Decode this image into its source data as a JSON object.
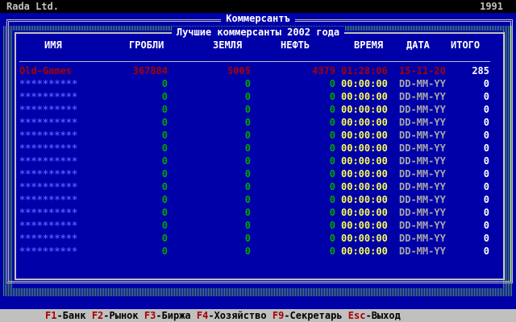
{
  "header": {
    "company": "Rada Ltd.",
    "year": "1991"
  },
  "window": {
    "title": "Коммерсантъ",
    "subtitle": "Лучшие коммерсанты 2002 года"
  },
  "columns": [
    "ИМЯ",
    "ГРОБЛИ",
    "ЗЕМЛЯ",
    "НЕФТЬ",
    "ВРЕМЯ",
    "ДАТА",
    "ИТОГО"
  ],
  "leaderboard": [
    {
      "name": "Old-Games",
      "grobli": "367884",
      "zemlya": "5005",
      "neft": "4379",
      "time": "01:28:06",
      "date": "15-11-20",
      "total": "285"
    },
    {
      "name": "**********",
      "grobli": "0",
      "zemlya": "0",
      "neft": "0",
      "time": "00:00:00",
      "date": "DD-MM-YY",
      "total": "0"
    },
    {
      "name": "**********",
      "grobli": "0",
      "zemlya": "0",
      "neft": "0",
      "time": "00:00:00",
      "date": "DD-MM-YY",
      "total": "0"
    },
    {
      "name": "**********",
      "grobli": "0",
      "zemlya": "0",
      "neft": "0",
      "time": "00:00:00",
      "date": "DD-MM-YY",
      "total": "0"
    },
    {
      "name": "**********",
      "grobli": "0",
      "zemlya": "0",
      "neft": "0",
      "time": "00:00:00",
      "date": "DD-MM-YY",
      "total": "0"
    },
    {
      "name": "**********",
      "grobli": "0",
      "zemlya": "0",
      "neft": "0",
      "time": "00:00:00",
      "date": "DD-MM-YY",
      "total": "0"
    },
    {
      "name": "**********",
      "grobli": "0",
      "zemlya": "0",
      "neft": "0",
      "time": "00:00:00",
      "date": "DD-MM-YY",
      "total": "0"
    },
    {
      "name": "**********",
      "grobli": "0",
      "zemlya": "0",
      "neft": "0",
      "time": "00:00:00",
      "date": "DD-MM-YY",
      "total": "0"
    },
    {
      "name": "**********",
      "grobli": "0",
      "zemlya": "0",
      "neft": "0",
      "time": "00:00:00",
      "date": "DD-MM-YY",
      "total": "0"
    },
    {
      "name": "**********",
      "grobli": "0",
      "zemlya": "0",
      "neft": "0",
      "time": "00:00:00",
      "date": "DD-MM-YY",
      "total": "0"
    },
    {
      "name": "**********",
      "grobli": "0",
      "zemlya": "0",
      "neft": "0",
      "time": "00:00:00",
      "date": "DD-MM-YY",
      "total": "0"
    },
    {
      "name": "**********",
      "grobli": "0",
      "zemlya": "0",
      "neft": "0",
      "time": "00:00:00",
      "date": "DD-MM-YY",
      "total": "0"
    },
    {
      "name": "**********",
      "grobli": "0",
      "zemlya": "0",
      "neft": "0",
      "time": "00:00:00",
      "date": "DD-MM-YY",
      "total": "0"
    },
    {
      "name": "**********",
      "grobli": "0",
      "zemlya": "0",
      "neft": "0",
      "time": "00:00:00",
      "date": "DD-MM-YY",
      "total": "0"
    },
    {
      "name": "**********",
      "grobli": "0",
      "zemlya": "0",
      "neft": "0",
      "time": "00:00:00",
      "date": "DD-MM-YY",
      "total": "0"
    }
  ],
  "statusbar": [
    {
      "key": "F1",
      "label": "-Банк"
    },
    {
      "key": "F2",
      "label": "-Рынок"
    },
    {
      "key": "F3",
      "label": "-Биржа"
    },
    {
      "key": "F4",
      "label": "-Хозяйство"
    },
    {
      "key": "F9",
      "label": "-Секретарь"
    },
    {
      "key": "Esc",
      "label": "-Выход"
    }
  ],
  "colors": {
    "background": "#0000a8",
    "top_row": "#a80000",
    "name_placeholder": "#5454fc",
    "zero_value": "#00a800",
    "time": "#fcfc54",
    "date": "#a8a8a8",
    "total": "#ffffff",
    "fkey": "#a80000"
  }
}
